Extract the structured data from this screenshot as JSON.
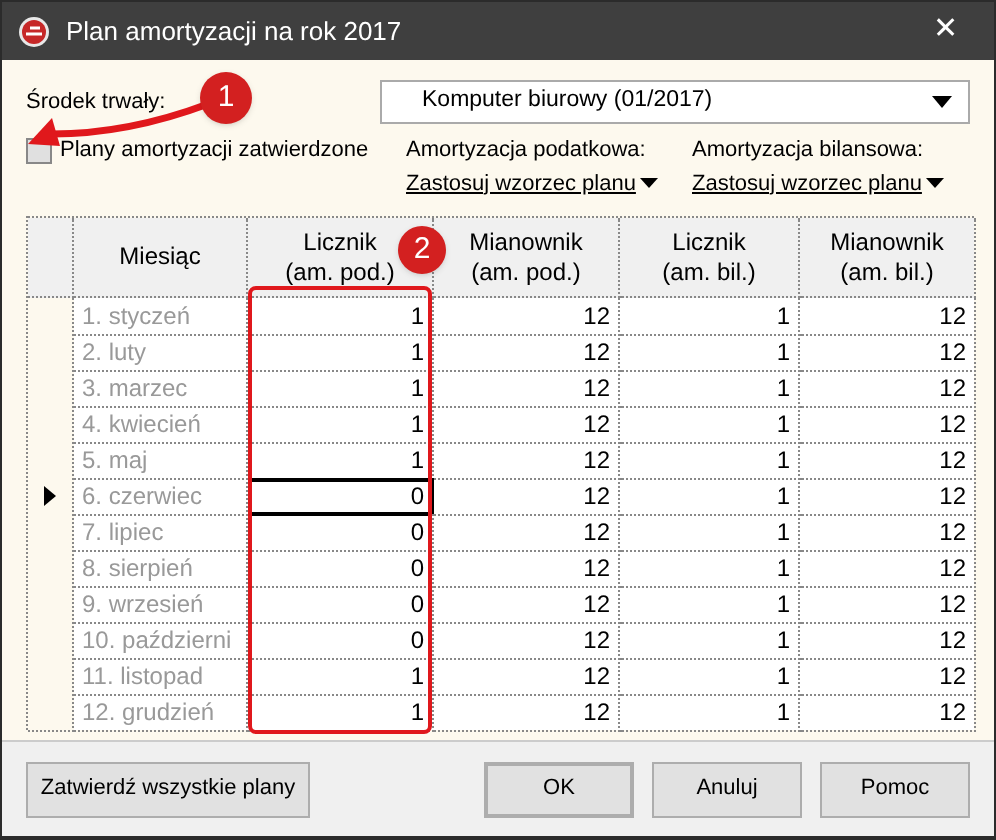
{
  "window": {
    "title": "Plan amortyzacji na rok 2017",
    "close": "✕"
  },
  "asset": {
    "label": "Środek trwały:",
    "value": "Komputer biurowy (01/2017)"
  },
  "approved": {
    "label": "Plany amortyzacji zatwierdzone",
    "checked": false
  },
  "tax": {
    "label": "Amortyzacja podatkowa:",
    "link": "Zastosuj wzorzec planu"
  },
  "balance": {
    "label": "Amortyzacja bilansowa:",
    "link": "Zastosuj wzorzec planu"
  },
  "table": {
    "columns": [
      "Miesiąc",
      "Licznik\n(am. pod.)",
      "Mianownik\n(am. pod.)",
      "Licznik\n(am. bil.)",
      "Mianownik\n(am. bil.)"
    ],
    "rows": [
      {
        "month": "1. styczeń",
        "values": [
          "1",
          "12",
          "1",
          "12"
        ],
        "selected": false
      },
      {
        "month": "2. luty",
        "values": [
          "1",
          "12",
          "1",
          "12"
        ],
        "selected": false
      },
      {
        "month": "3. marzec",
        "values": [
          "1",
          "12",
          "1",
          "12"
        ],
        "selected": false
      },
      {
        "month": "4. kwiecień",
        "values": [
          "1",
          "12",
          "1",
          "12"
        ],
        "selected": false
      },
      {
        "month": "5. maj",
        "values": [
          "1",
          "12",
          "1",
          "12"
        ],
        "selected": false
      },
      {
        "month": "6. czerwiec",
        "values": [
          "0",
          "12",
          "1",
          "12"
        ],
        "selected": true
      },
      {
        "month": "7. lipiec",
        "values": [
          "0",
          "12",
          "1",
          "12"
        ],
        "selected": false
      },
      {
        "month": "8. sierpień",
        "values": [
          "0",
          "12",
          "1",
          "12"
        ],
        "selected": false
      },
      {
        "month": "9. wrzesień",
        "values": [
          "0",
          "12",
          "1",
          "12"
        ],
        "selected": false
      },
      {
        "month": "10. październi",
        "values": [
          "0",
          "12",
          "1",
          "12"
        ],
        "selected": false
      },
      {
        "month": "11. listopad",
        "values": [
          "1",
          "12",
          "1",
          "12"
        ],
        "selected": false
      },
      {
        "month": "12. grudzień",
        "values": [
          "1",
          "12",
          "1",
          "12"
        ],
        "selected": false
      }
    ]
  },
  "annotations": [
    "1",
    "2"
  ],
  "buttons": [
    "Zatwierdź wszystkie plany",
    "OK",
    "Anuluj",
    "Pomoc"
  ]
}
